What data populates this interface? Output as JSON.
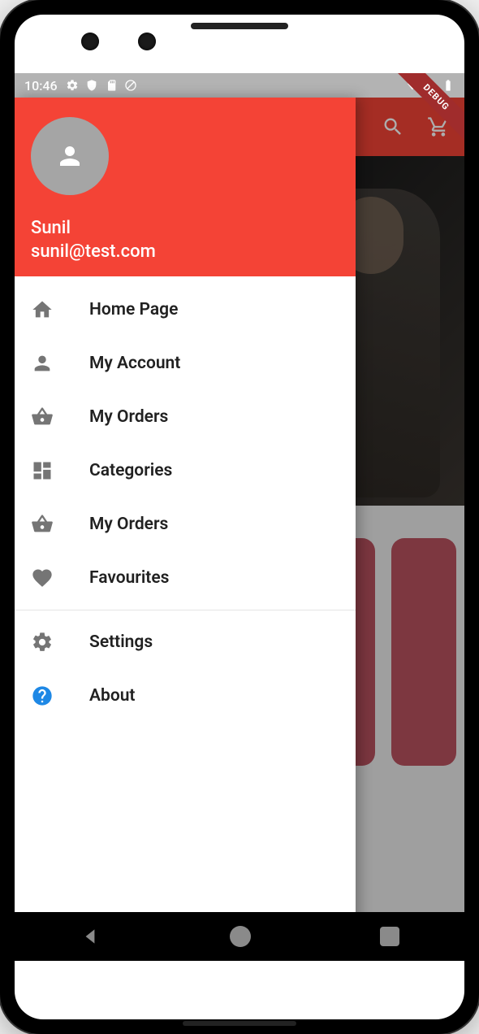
{
  "status_bar": {
    "time": "10:46"
  },
  "debug": {
    "label": "DEBUG"
  },
  "user": {
    "name": "Sunil",
    "email": "sunil@test.com"
  },
  "drawer": {
    "items": [
      {
        "icon": "home-icon",
        "label": "Home Page"
      },
      {
        "icon": "person-icon",
        "label": "My Account"
      },
      {
        "icon": "basket-icon",
        "label": "My Orders"
      },
      {
        "icon": "dashboard-icon",
        "label": "Categories"
      },
      {
        "icon": "basket-icon",
        "label": "My Orders"
      },
      {
        "icon": "heart-icon",
        "label": "Favourites"
      }
    ],
    "secondary_items": [
      {
        "icon": "gear-icon",
        "label": "Settings"
      },
      {
        "icon": "help-icon",
        "label": "About",
        "icon_color": "blue"
      }
    ]
  },
  "app_bar": {
    "search_icon": "search",
    "cart_icon": "cart"
  }
}
